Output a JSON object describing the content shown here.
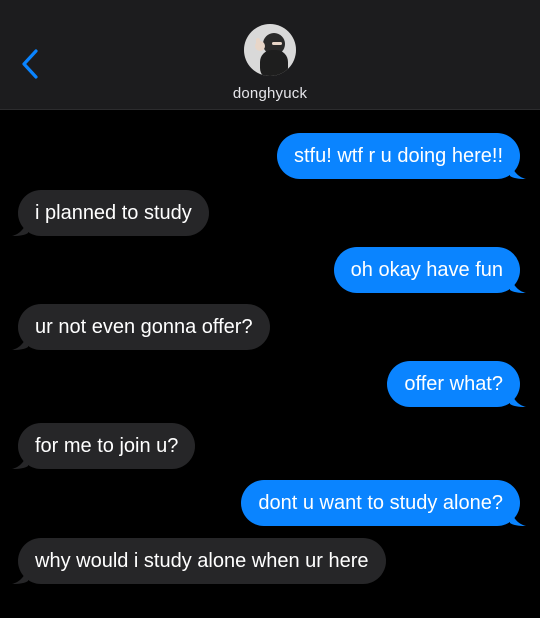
{
  "contact": {
    "name": "donghyuck"
  },
  "icons": {
    "back": "chevron-left-icon",
    "avatar": "contact-avatar"
  },
  "colors": {
    "sent": "#0a84ff",
    "received": "#262628",
    "accent": "#0a84ff"
  },
  "messages": [
    {
      "from": "me",
      "text": "stfu! wtf r u doing here!!"
    },
    {
      "from": "them",
      "text": "i planned to study"
    },
    {
      "from": "me",
      "text": "oh okay have fun"
    },
    {
      "from": "them",
      "text": "ur not even gonna offer?"
    },
    {
      "from": "me",
      "text": "offer what?"
    },
    {
      "from": "them",
      "text": "for me to join u?"
    },
    {
      "from": "me",
      "text": "dont u want to study alone?"
    },
    {
      "from": "them",
      "text": "why would i study alone when ur here"
    }
  ]
}
